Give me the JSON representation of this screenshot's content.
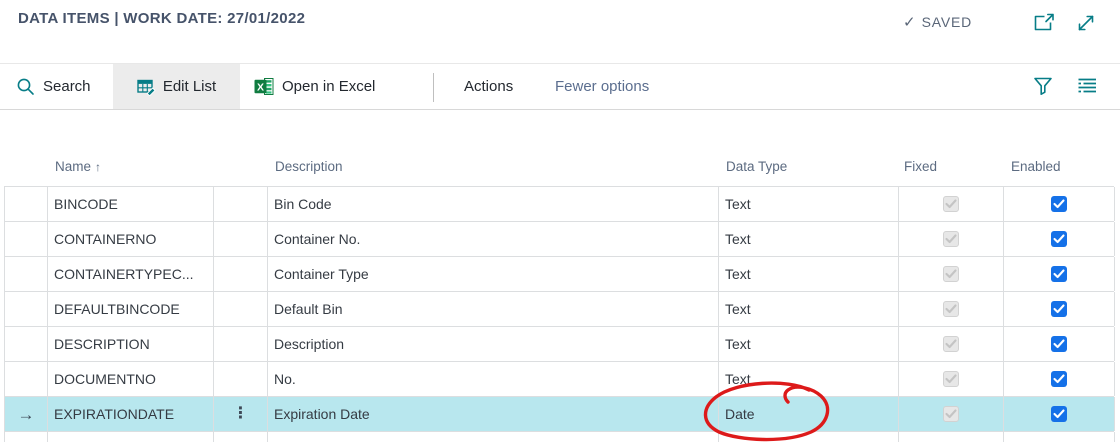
{
  "header": {
    "title": "DATA ITEMS | WORK DATE: 27/01/2022",
    "saved_check": "✓",
    "saved_label": "SAVED"
  },
  "toolbar": {
    "search_label": "Search",
    "edit_list_label": "Edit List",
    "open_in_excel_label": "Open in Excel",
    "actions_label": "Actions",
    "fewer_options_label": "Fewer options"
  },
  "table": {
    "columns": {
      "name": "Name",
      "name_sort_indicator": "↑",
      "description": "Description",
      "data_type": "Data Type",
      "fixed": "Fixed",
      "enabled": "Enabled"
    },
    "selected_row_arrow": "→",
    "row_menu_icon": "⋮",
    "rows": [
      {
        "name": "BINCODE",
        "description": "Bin Code",
        "data_type": "Text",
        "fixed": true,
        "enabled": true,
        "selected": false
      },
      {
        "name": "CONTAINERNO",
        "description": "Container No.",
        "data_type": "Text",
        "fixed": true,
        "enabled": true,
        "selected": false
      },
      {
        "name": "CONTAINERTYPEC...",
        "description": "Container Type",
        "data_type": "Text",
        "fixed": true,
        "enabled": true,
        "selected": false
      },
      {
        "name": "DEFAULTBINCODE",
        "description": "Default Bin",
        "data_type": "Text",
        "fixed": true,
        "enabled": true,
        "selected": false
      },
      {
        "name": "DESCRIPTION",
        "description": "Description",
        "data_type": "Text",
        "fixed": true,
        "enabled": true,
        "selected": false
      },
      {
        "name": "DOCUMENTNO",
        "description": "No.",
        "data_type": "Text",
        "fixed": true,
        "enabled": true,
        "selected": false
      },
      {
        "name": "EXPIRATIONDATE",
        "description": "Expiration Date",
        "data_type": "Date",
        "fixed": true,
        "enabled": true,
        "selected": true
      }
    ]
  },
  "annotation": {
    "type": "hand-drawn-red-circle",
    "circled_value": "Date",
    "color": "#dd1a1a"
  },
  "colors": {
    "accent_teal": "#077d87",
    "excel_green": "#107c41",
    "checkbox_blue": "#1571e8",
    "selected_row_bg": "#b8e7ee",
    "title_text": "#46536a"
  }
}
